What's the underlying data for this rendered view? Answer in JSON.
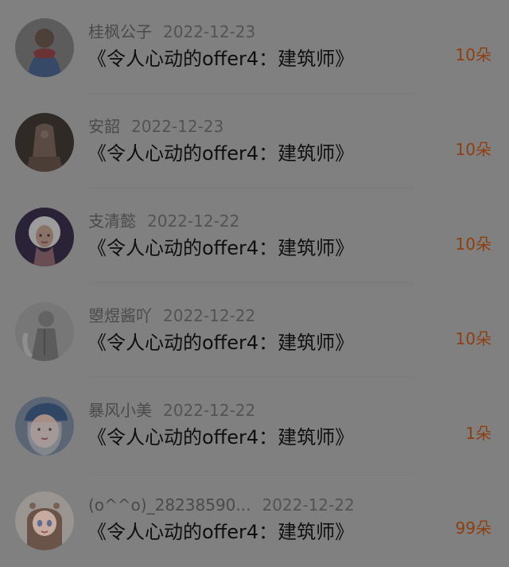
{
  "list": {
    "items": [
      {
        "username": "桂枫公子",
        "date": "2022-12-23",
        "title": "《令人心动的offer4：建筑师》",
        "gift_count": "10朵",
        "avatar_icon": "portrait-avatar-icon"
      },
      {
        "username": "安韶",
        "date": "2022-12-23",
        "title": "《令人心动的offer4：建筑师》",
        "gift_count": "10朵",
        "avatar_icon": "dress-avatar-icon"
      },
      {
        "username": "支清懿",
        "date": "2022-12-22",
        "title": "《令人心动的offer4：建筑师》",
        "gift_count": "10朵",
        "avatar_icon": "cartoon-girl-avatar-icon"
      },
      {
        "username": "曌煜酱吖",
        "date": "2022-12-22",
        "title": "《令人心动的offer4：建筑师》",
        "gift_count": "10朵",
        "avatar_icon": "sketch-avatar-icon"
      },
      {
        "username": "暴风小美",
        "date": "2022-12-22",
        "title": "《令人心动的offer4：建筑师》",
        "gift_count": "1朵",
        "avatar_icon": "blue-hat-avatar-icon"
      },
      {
        "username": "(o^^o)_28238590...",
        "date": "2022-12-22",
        "title": "《令人心动的offer4：建筑师》",
        "gift_count": "99朵",
        "avatar_icon": "anime-girl-avatar-icon"
      }
    ]
  },
  "colors": {
    "overlay_background": "#808080",
    "name_text": "#4a4a4a",
    "date_text": "#535353",
    "title_text": "#0f0f0f",
    "gift_count": "#8d3f0f"
  }
}
